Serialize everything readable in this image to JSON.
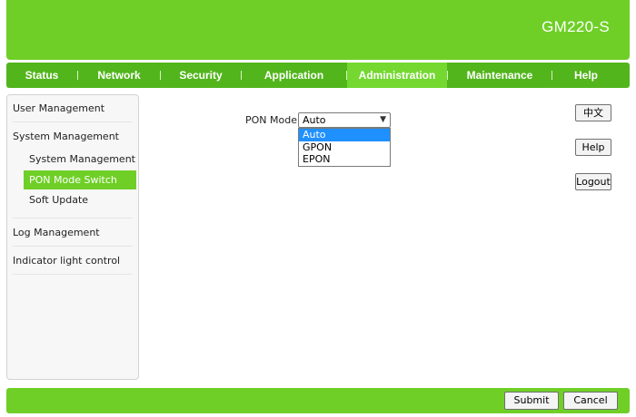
{
  "header": {
    "model": "GM220-S"
  },
  "nav": {
    "items": [
      {
        "label": "Status"
      },
      {
        "label": "Network"
      },
      {
        "label": "Security"
      },
      {
        "label": "Application"
      },
      {
        "label": "Administration"
      },
      {
        "label": "Maintenance"
      },
      {
        "label": "Help"
      }
    ],
    "active": "Administration"
  },
  "sidebar": {
    "items": [
      {
        "label": "User Management"
      },
      {
        "label": "System Management"
      },
      {
        "label": "Log Management"
      },
      {
        "label": "Indicator light control"
      }
    ],
    "sub_items": [
      {
        "label": "System Management"
      },
      {
        "label": "PON Mode Switch"
      },
      {
        "label": "Soft Update"
      }
    ],
    "active_sub": "PON Mode Switch"
  },
  "form": {
    "pon_mode_label": "PON Mode",
    "pon_mode_value": "Auto",
    "pon_mode_options": [
      "Auto",
      "GPON",
      "EPON"
    ]
  },
  "right_buttons": {
    "language": "中文",
    "help": "Help",
    "logout": "Logout"
  },
  "footer": {
    "submit": "Submit",
    "cancel": "Cancel"
  },
  "colors": {
    "brand_green": "#6fcf27",
    "nav_green": "#52b51c",
    "active_tab": "#74d830",
    "dropdown_highlight": "#1e90ff"
  }
}
